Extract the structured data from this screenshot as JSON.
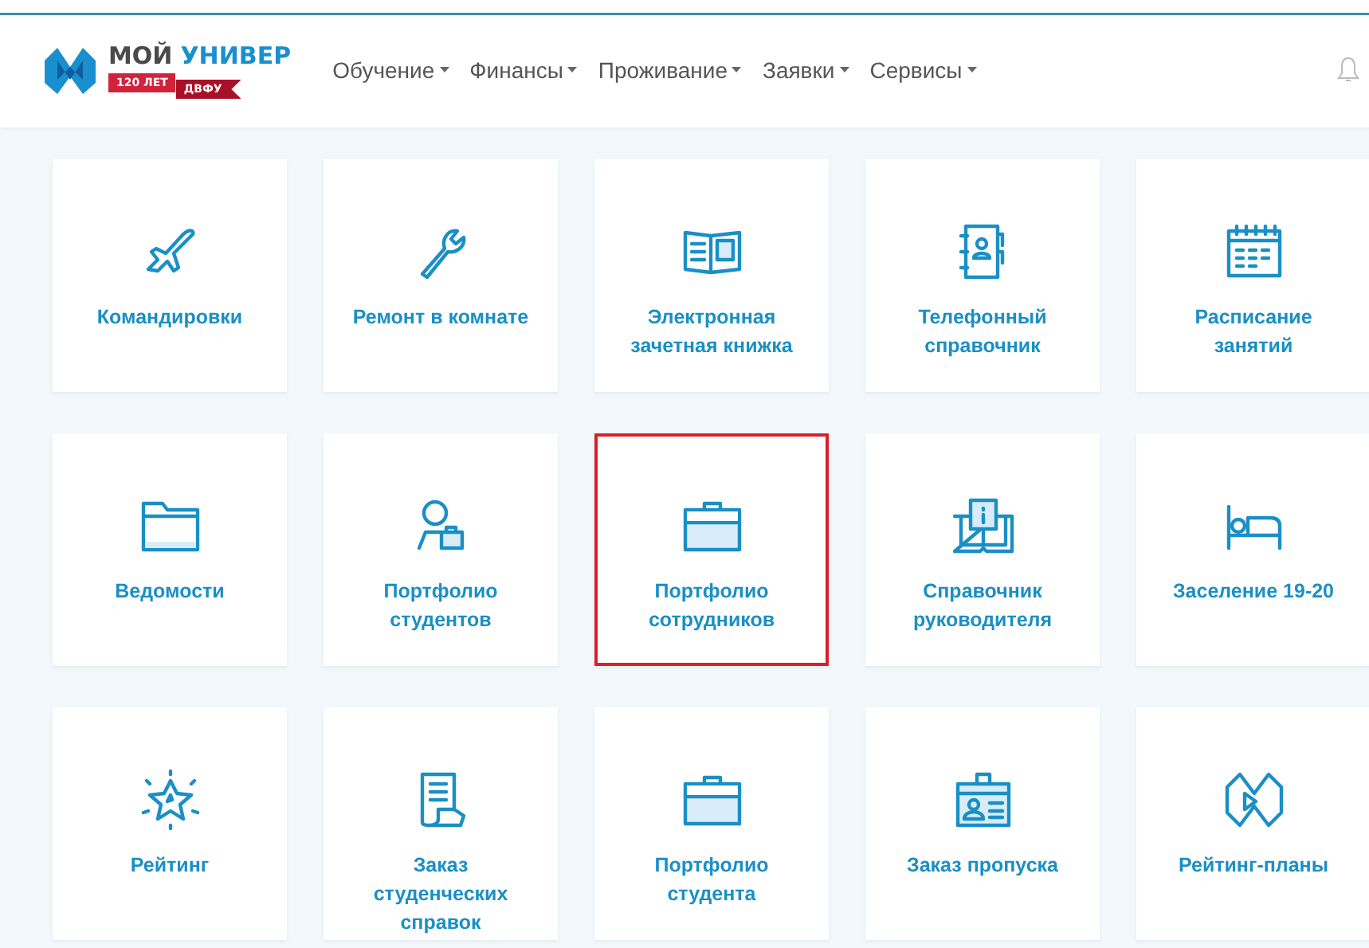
{
  "logo": {
    "word1": "МОЙ",
    "word2": "УНИВЕР",
    "ribbon_years": "120 ЛЕТ",
    "ribbon_org": "ДВФУ"
  },
  "nav": [
    {
      "label": "Обучение"
    },
    {
      "label": "Финансы"
    },
    {
      "label": "Проживание"
    },
    {
      "label": "Заявки"
    },
    {
      "label": "Сервисы"
    }
  ],
  "tiles": [
    {
      "label": "Командировки",
      "selected": false
    },
    {
      "label": "Ремонт в комнате",
      "selected": false
    },
    {
      "label": "Электронная зачетная книжка",
      "selected": false
    },
    {
      "label": "Телефонный справочник",
      "selected": false
    },
    {
      "label": "Расписание занятий",
      "selected": false
    },
    {
      "label": "Ведомости",
      "selected": false
    },
    {
      "label": "Портфолио студентов",
      "selected": false
    },
    {
      "label": "Портфолио сотрудников",
      "selected": true
    },
    {
      "label": "Справочник руководителя",
      "selected": false
    },
    {
      "label": "Заселение 19-20",
      "selected": false
    },
    {
      "label": "Рейтинг",
      "selected": false
    },
    {
      "label": "Заказ студенческих справок",
      "selected": false
    },
    {
      "label": "Портфолио студента",
      "selected": false
    },
    {
      "label": "Заказ пропуска",
      "selected": false
    },
    {
      "label": "Рейтинг-планы",
      "selected": false
    }
  ]
}
